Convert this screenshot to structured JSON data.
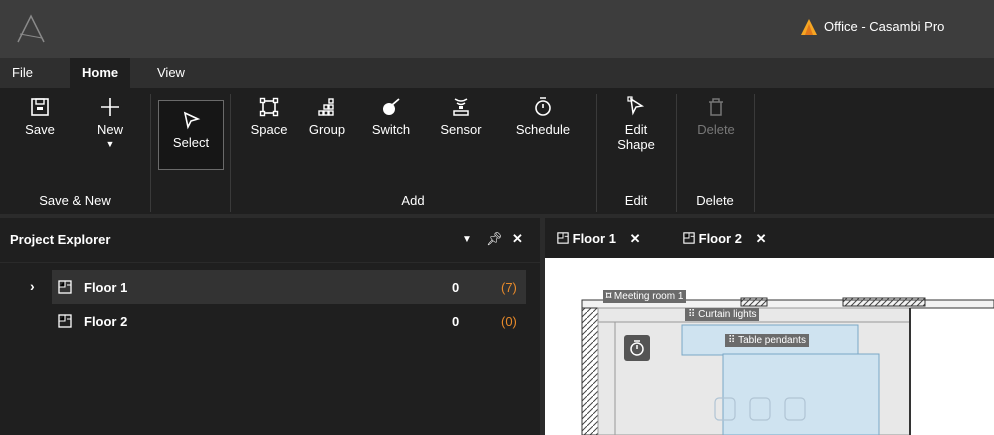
{
  "titlebar": {
    "app_title": "Office - Casambi Pro"
  },
  "menu": {
    "tabs": [
      "File",
      "Home",
      "View"
    ]
  },
  "ribbon": {
    "buttons": {
      "save": "Save",
      "new": "New",
      "select": "Select",
      "space": "Space",
      "group": "Group",
      "switch": "Switch",
      "sensor": "Sensor",
      "schedule": "Schedule",
      "edit_shape_line1": "Edit",
      "edit_shape_line2": "Shape",
      "delete": "Delete"
    },
    "groups": {
      "save_new": "Save & New",
      "add": "Add",
      "edit": "Edit",
      "delete": "Delete"
    },
    "icons": [
      "save-icon",
      "new-icon",
      "select-icon",
      "space-icon",
      "group-icon",
      "switch-icon",
      "sensor-icon",
      "schedule-icon",
      "edit-shape-icon",
      "delete-icon"
    ]
  },
  "explorer": {
    "title": "Project Explorer",
    "items": [
      {
        "label": "Floor 1",
        "count": "0",
        "secondary": "(7)"
      },
      {
        "label": "Floor 2",
        "count": "0",
        "secondary": "(0)"
      }
    ]
  },
  "canvas": {
    "tabs": [
      "Floor 1",
      "Floor 2"
    ],
    "labels": {
      "meeting_room": "Meeting room 1",
      "curtain": "Curtain lights",
      "pendants": "Table pendants"
    }
  },
  "colors": {
    "accent_orange": "#e88a2a",
    "ribbon_bg": "#1f1f1f"
  }
}
